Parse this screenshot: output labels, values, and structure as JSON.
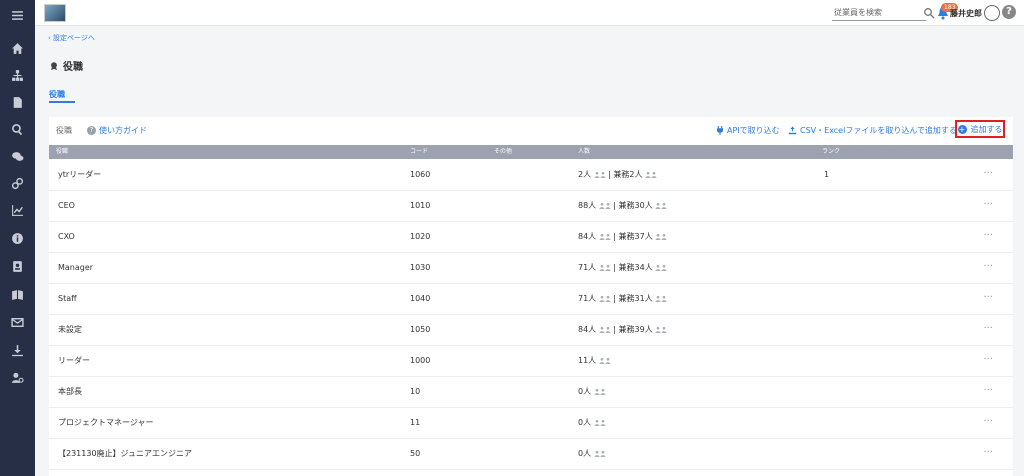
{
  "header": {
    "search_placeholder": "従業員を検索",
    "notification_count": "183",
    "user_name": "藤井史郎",
    "help_label": "?"
  },
  "breadcrumb": {
    "back": "設定ページへ"
  },
  "page": {
    "title": "役職",
    "tab": "役職"
  },
  "toolbar": {
    "section_label": "役職",
    "guide": "使い方ガイド",
    "api_import": "APIで取り込む",
    "csv_import": "CSV・Excelファイルを取り込んで追加する",
    "add": "追加する"
  },
  "table": {
    "headers": [
      "役職",
      "コード",
      "その他",
      "人数",
      "ランク"
    ],
    "rows": [
      {
        "name": "ytrリーダー",
        "code": "1060",
        "people": "2人",
        "concurrent": "| 兼務2人",
        "rank": "1"
      },
      {
        "name": "CEO",
        "code": "1010",
        "people": "88人",
        "concurrent": "| 兼務30人",
        "rank": ""
      },
      {
        "name": "CXO",
        "code": "1020",
        "people": "84人",
        "concurrent": "| 兼務37人",
        "rank": ""
      },
      {
        "name": "Manager",
        "code": "1030",
        "people": "71人",
        "concurrent": "| 兼務34人",
        "rank": ""
      },
      {
        "name": "Staff",
        "code": "1040",
        "people": "71人",
        "concurrent": "| 兼務31人",
        "rank": ""
      },
      {
        "name": "未設定",
        "code": "1050",
        "people": "84人",
        "concurrent": "| 兼務39人",
        "rank": ""
      },
      {
        "name": "リーダー",
        "code": "1000",
        "people": "11人",
        "concurrent": "",
        "rank": ""
      },
      {
        "name": "本部長",
        "code": "10",
        "people": "0人",
        "concurrent": "",
        "rank": ""
      },
      {
        "name": "プロジェクトマネージャー",
        "code": "11",
        "people": "0人",
        "concurrent": "",
        "rank": ""
      },
      {
        "name": "【231130廃止】ジュニアエンジニア",
        "code": "50",
        "people": "0人",
        "concurrent": "",
        "rank": ""
      }
    ],
    "more": "···"
  },
  "colors": {
    "accent": "#2f7be0",
    "sidebar": "#262f45",
    "header_row": "#9da2b0",
    "highlight": "#e02020"
  }
}
